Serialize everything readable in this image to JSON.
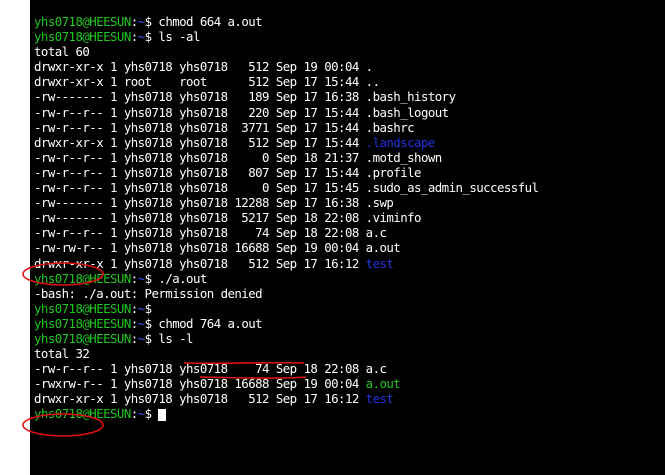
{
  "colors": {
    "background": "#000000",
    "text": "#ffffff",
    "prompt_user": "#1ec81e",
    "prompt_path": "#3b5bff",
    "executable": "#1ec81e",
    "directory": "#2233dd",
    "annotation": "#e01010"
  },
  "prompt": {
    "user_host": "yhs0718@HEESUN",
    "separator": ":",
    "path": "~",
    "symbol": "$ "
  },
  "lines": [
    {
      "kind": "cmd",
      "text": "chmod 664 a.out"
    },
    {
      "kind": "cmd",
      "text": "ls -al"
    },
    {
      "kind": "out",
      "text": "total 60"
    },
    {
      "kind": "ls",
      "text": "drwxr-xr-x 1 yhs0718 yhs0718   512 Sep 19 00:04 ",
      "name": ".",
      "style": "plain"
    },
    {
      "kind": "ls",
      "text": "drwxr-xr-x 1 root    root      512 Sep 17 15:44 ",
      "name": "..",
      "style": "plain"
    },
    {
      "kind": "ls",
      "text": "-rw------- 1 yhs0718 yhs0718   189 Sep 17 16:38 ",
      "name": ".bash_history",
      "style": "plain"
    },
    {
      "kind": "ls",
      "text": "-rw-r--r-- 1 yhs0718 yhs0718   220 Sep 17 15:44 ",
      "name": ".bash_logout",
      "style": "plain"
    },
    {
      "kind": "ls",
      "text": "-rw-r--r-- 1 yhs0718 yhs0718  3771 Sep 17 15:44 ",
      "name": ".bashrc",
      "style": "plain"
    },
    {
      "kind": "ls",
      "text": "drwxr-xr-x 1 yhs0718 yhs0718   512 Sep 17 15:44 ",
      "name": ".landscape",
      "style": "dir"
    },
    {
      "kind": "ls",
      "text": "-rw-r--r-- 1 yhs0718 yhs0718     0 Sep 18 21:37 ",
      "name": ".motd_shown",
      "style": "plain"
    },
    {
      "kind": "ls",
      "text": "-rw-r--r-- 1 yhs0718 yhs0718   807 Sep 17 15:44 ",
      "name": ".profile",
      "style": "plain"
    },
    {
      "kind": "ls",
      "text": "-rw-r--r-- 1 yhs0718 yhs0718     0 Sep 17 15:45 ",
      "name": ".sudo_as_admin_successful",
      "style": "plain"
    },
    {
      "kind": "ls",
      "text": "-rw------- 1 yhs0718 yhs0718 12288 Sep 17 16:38 ",
      "name": ".swp",
      "style": "plain"
    },
    {
      "kind": "ls",
      "text": "-rw------- 1 yhs0718 yhs0718  5217 Sep 18 22:08 ",
      "name": ".viminfo",
      "style": "plain"
    },
    {
      "kind": "ls",
      "text": "-rw-r--r-- 1 yhs0718 yhs0718    74 Sep 18 22:08 ",
      "name": "a.c",
      "style": "plain"
    },
    {
      "kind": "ls",
      "text": "-rw-rw-r-- 1 yhs0718 yhs0718 16688 Sep 19 00:04 ",
      "name": "a.out",
      "style": "plain"
    },
    {
      "kind": "ls",
      "text": "drwxr-xr-x 1 yhs0718 yhs0718   512 Sep 17 16:12 ",
      "name": "test",
      "style": "dir"
    },
    {
      "kind": "cmd",
      "text": "./a.out"
    },
    {
      "kind": "out",
      "text": "-bash: ./a.out: Permission denied"
    },
    {
      "kind": "cmd",
      "text": ""
    },
    {
      "kind": "cmd",
      "text": "chmod 764 a.out"
    },
    {
      "kind": "cmd",
      "text": "ls -l"
    },
    {
      "kind": "out",
      "text": "total 32"
    },
    {
      "kind": "ls",
      "text": "-rw-r--r-- 1 yhs0718 yhs0718    74 Sep 18 22:08 ",
      "name": "a.c",
      "style": "plain"
    },
    {
      "kind": "ls",
      "text": "-rwxrw-r-- 1 yhs0718 yhs0718 16688 Sep 19 00:04 ",
      "name": "a.out",
      "style": "exec"
    },
    {
      "kind": "ls",
      "text": "drwxr-xr-x 1 yhs0718 yhs0718   512 Sep 17 16:12 ",
      "name": "test",
      "style": "dir"
    },
    {
      "kind": "cmd",
      "text": "",
      "cursor": true
    }
  ]
}
